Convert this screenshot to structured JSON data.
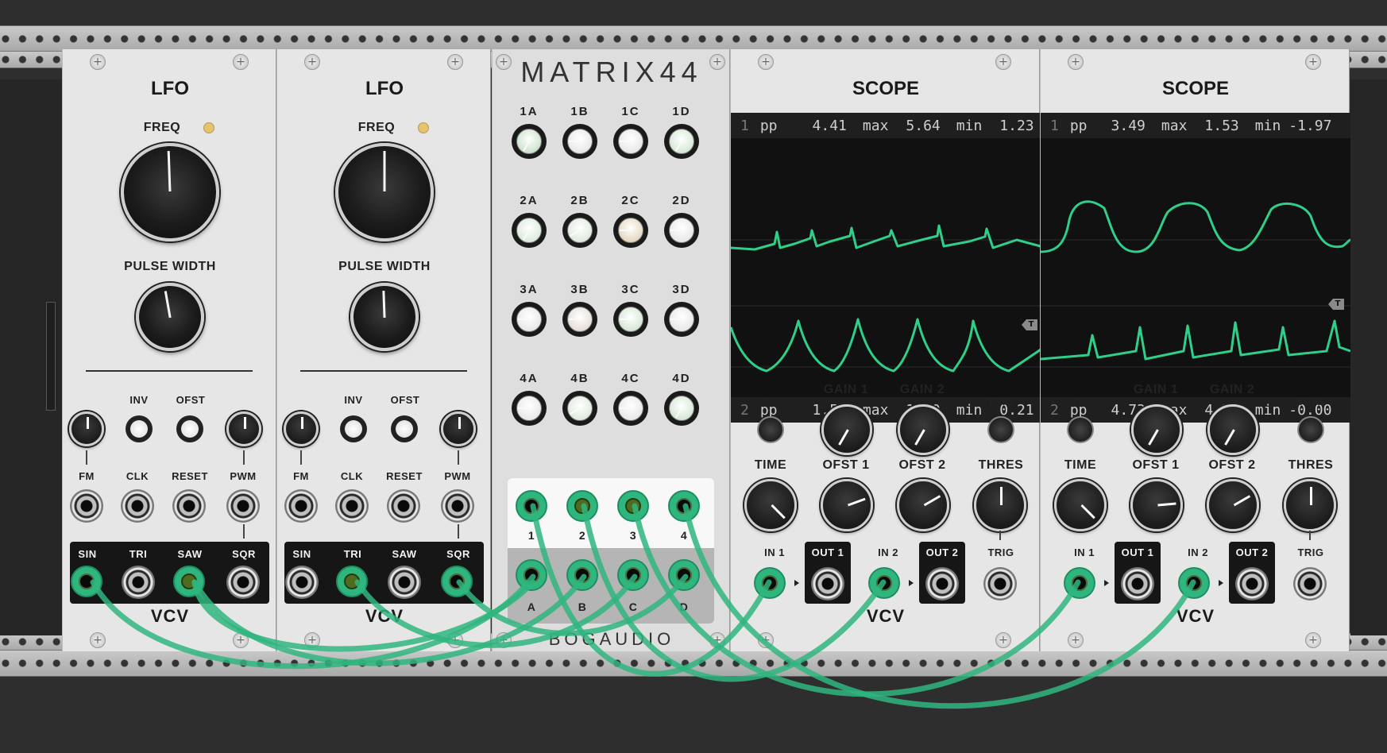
{
  "colors": {
    "cable": "#2fb57e",
    "trace": "#2fcf8a",
    "panel": "#e6e6e6",
    "rack": "#2e2e2e"
  },
  "lfo": [
    {
      "title": "LFO",
      "freq": "FREQ",
      "pulse_width": "PULSE WIDTH",
      "inv": "INV",
      "ofst": "OFST",
      "fm": "FM",
      "clk": "CLK",
      "reset": "RESET",
      "pwm": "PWM",
      "sin": "SIN",
      "tri": "TRI",
      "saw": "SAW",
      "sqr": "SQR",
      "brand": "VCV"
    },
    {
      "title": "LFO",
      "freq": "FREQ",
      "pulse_width": "PULSE WIDTH",
      "inv": "INV",
      "ofst": "OFST",
      "fm": "FM",
      "clk": "CLK",
      "reset": "RESET",
      "pwm": "PWM",
      "sin": "SIN",
      "tri": "TRI",
      "saw": "SAW",
      "sqr": "SQR",
      "brand": "VCV"
    }
  ],
  "matrix": {
    "title": "MATRIX44",
    "brand": "BOGAUDIO",
    "knobs": [
      [
        "1A",
        "1B",
        "1C",
        "1D"
      ],
      [
        "2A",
        "2B",
        "2C",
        "2D"
      ],
      [
        "3A",
        "3B",
        "3C",
        "3D"
      ],
      [
        "4A",
        "4B",
        "4C",
        "4D"
      ]
    ],
    "outputs": [
      "1",
      "2",
      "3",
      "4"
    ],
    "inputs": [
      "A",
      "B",
      "C",
      "D"
    ]
  },
  "scope": [
    {
      "title": "SCOPE",
      "ch1": {
        "ch": "1",
        "pp_label": "pp",
        "pp": "4.41",
        "max_label": "max",
        "max": "5.64",
        "min_label": "min",
        "min": "1.23"
      },
      "ch2": {
        "ch": "2",
        "pp_label": "pp",
        "pp": "1.58",
        "max_label": "max",
        "max": "1.80",
        "min_label": "min",
        "min": "0.21"
      },
      "x1x2": "1x2",
      "gain1": "GAIN 1",
      "gain2": "GAIN 2",
      "trig_btn": "TRIG",
      "time": "TIME",
      "ofst1": "OFST 1",
      "ofst2": "OFST 2",
      "thres": "THRES",
      "in1": "IN 1",
      "out1": "OUT 1",
      "in2": "IN 2",
      "out2": "OUT 2",
      "trig": "TRIG",
      "brand": "VCV",
      "marker": "T"
    },
    {
      "title": "SCOPE",
      "ch1": {
        "ch": "1",
        "pp_label": "pp",
        "pp": "3.49",
        "max_label": "max",
        "max": "1.53",
        "min_label": "min",
        "min": "-1.97"
      },
      "ch2": {
        "ch": "2",
        "pp_label": "pp",
        "pp": "4.73",
        "max_label": "max",
        "max": "4.73",
        "min_label": "min",
        "min": "-0.00"
      },
      "x1x2": "1x2",
      "gain1": "GAIN 1",
      "gain2": "GAIN 2",
      "trig_btn": "TRIG",
      "time": "TIME",
      "ofst1": "OFST 1",
      "ofst2": "OFST 2",
      "thres": "THRES",
      "in1": "IN 1",
      "out1": "OUT 1",
      "in2": "IN 2",
      "out2": "OUT 2",
      "trig": "TRIG",
      "brand": "VCV",
      "marker": "T"
    }
  ]
}
